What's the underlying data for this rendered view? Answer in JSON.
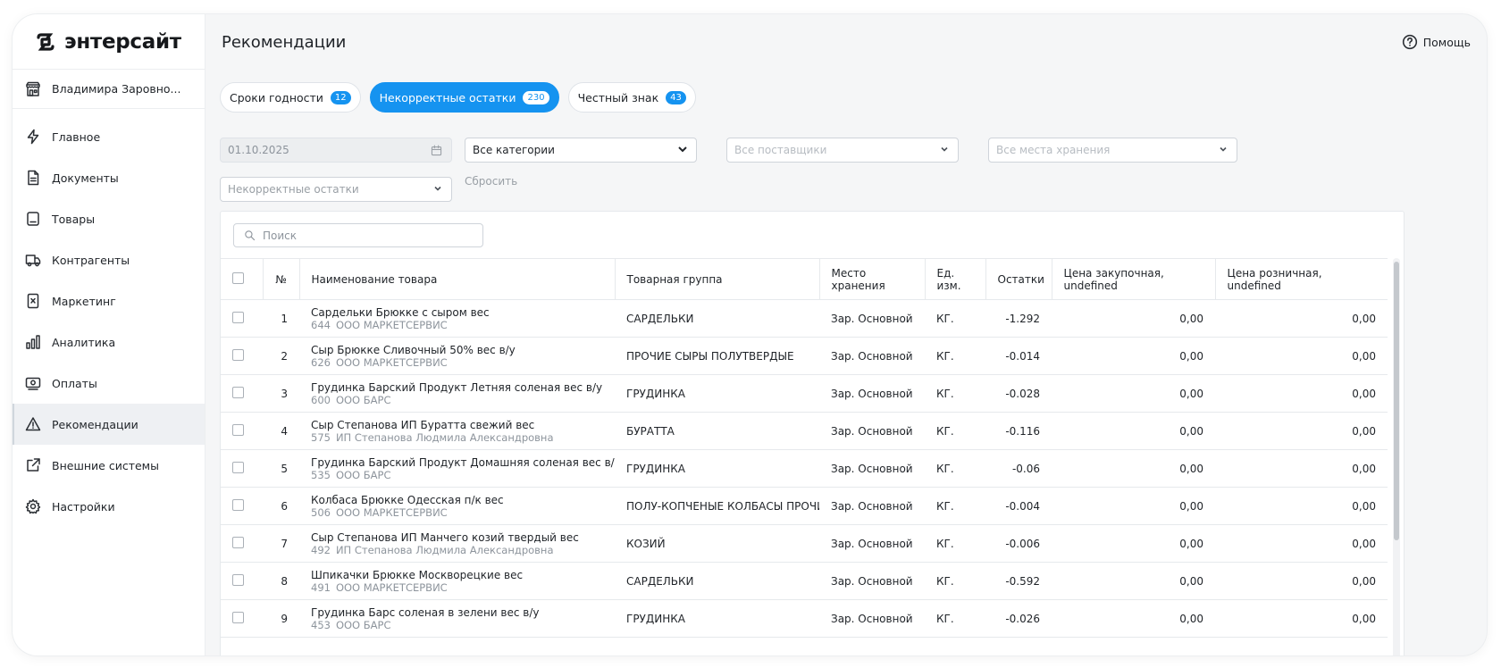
{
  "brand": {
    "name": "энтерсайт"
  },
  "store": {
    "name": "Владимира Заровно..."
  },
  "sidebar": {
    "items": [
      {
        "label": "Главное",
        "icon": "lightning-icon"
      },
      {
        "label": "Документы",
        "icon": "document-icon"
      },
      {
        "label": "Товары",
        "icon": "product-icon"
      },
      {
        "label": "Контрагенты",
        "icon": "truck-icon"
      },
      {
        "label": "Маркетинг",
        "icon": "marketing-icon"
      },
      {
        "label": "Аналитика",
        "icon": "bar-chart-icon"
      },
      {
        "label": "Оплаты",
        "icon": "payment-icon"
      },
      {
        "label": "Рекомендации",
        "icon": "warning-icon",
        "active": true
      },
      {
        "label": "Внешние системы",
        "icon": "external-link-icon"
      },
      {
        "label": "Настройки",
        "icon": "gear-icon"
      }
    ]
  },
  "header": {
    "title": "Рекомендации",
    "help_label": "Помощь"
  },
  "tabs": [
    {
      "label": "Сроки годности",
      "count": "12",
      "active": false
    },
    {
      "label": "Некорректные остатки",
      "count": "230",
      "active": true
    },
    {
      "label": "Честный знак",
      "count": "43",
      "active": false
    }
  ],
  "filters": {
    "date": "01.10.2025",
    "category": "Все категории",
    "supplier_placeholder": "Все поставщики",
    "storage_placeholder": "Все места хранения",
    "type_placeholder": "Некорректные остатки",
    "reset_label": "Сбросить"
  },
  "search": {
    "placeholder": "Поиск"
  },
  "table": {
    "columns": [
      "№",
      "Наименование товара",
      "Товарная группа",
      "Место хранения",
      "Ед. изм.",
      "Остатки",
      "Цена закупочная, undefined",
      "Цена розничная, undefined"
    ],
    "rows": [
      {
        "n": "1",
        "name": "Сардельки Брюкке с сыром вес",
        "code": "644",
        "supplier": "ООО МАРКЕТСЕРВИС",
        "group": "САРДЕЛЬКИ",
        "storage": "Зар. Основной",
        "unit": "КГ.",
        "stock": "-1.292",
        "purchase": "0,00",
        "retail": "0,00"
      },
      {
        "n": "2",
        "name": "Сыр Брюкке Сливочный 50% вес в/у",
        "code": "626",
        "supplier": "ООО МАРКЕТСЕРВИС",
        "group": "ПРОЧИЕ СЫРЫ ПОЛУТВЕРДЫЕ",
        "storage": "Зар. Основной",
        "unit": "КГ.",
        "stock": "-0.014",
        "purchase": "0,00",
        "retail": "0,00"
      },
      {
        "n": "3",
        "name": "Грудинка Барский Продукт Летняя соленая вес в/у",
        "code": "600",
        "supplier": "ООО БАРС",
        "group": "ГРУДИНКА",
        "storage": "Зар. Основной",
        "unit": "КГ.",
        "stock": "-0.028",
        "purchase": "0,00",
        "retail": "0,00"
      },
      {
        "n": "4",
        "name": "Сыр Степанова ИП Буратта свежий вес",
        "code": "575",
        "supplier": "ИП Степанова Людмила Александровна",
        "group": "БУРАТТА",
        "storage": "Зар. Основной",
        "unit": "КГ.",
        "stock": "-0.116",
        "purchase": "0,00",
        "retail": "0,00"
      },
      {
        "n": "5",
        "name": "Грудинка Барский Продукт Домашняя соленая вес в/у",
        "code": "535",
        "supplier": "ООО БАРС",
        "group": "ГРУДИНКА",
        "storage": "Зар. Основной",
        "unit": "КГ.",
        "stock": "-0.06",
        "purchase": "0,00",
        "retail": "0,00"
      },
      {
        "n": "6",
        "name": "Колбаса Брюкке Одесская п/к вес",
        "code": "506",
        "supplier": "ООО МАРКЕТСЕРВИС",
        "group": "ПОЛУ-КОПЧЕНЫЕ КОЛБАСЫ ПРОЧИЕ",
        "storage": "Зар. Основной",
        "unit": "КГ.",
        "stock": "-0.004",
        "purchase": "0,00",
        "retail": "0,00"
      },
      {
        "n": "7",
        "name": "Сыр Степанова ИП Манчего козий твердый вес",
        "code": "492",
        "supplier": "ИП Степанова Людмила Александровна",
        "group": "КОЗИЙ",
        "storage": "Зар. Основной",
        "unit": "КГ.",
        "stock": "-0.006",
        "purchase": "0,00",
        "retail": "0,00"
      },
      {
        "n": "8",
        "name": "Шпикачки Брюкке Москворецкие вес",
        "code": "491",
        "supplier": "ООО МАРКЕТСЕРВИС",
        "group": "САРДЕЛЬКИ",
        "storage": "Зар. Основной",
        "unit": "КГ.",
        "stock": "-0.592",
        "purchase": "0,00",
        "retail": "0,00"
      },
      {
        "n": "9",
        "name": "Грудинка Барс соленая в зелени вес в/у",
        "code": "453",
        "supplier": "ООО БАРС",
        "group": "ГРУДИНКА",
        "storage": "Зар. Основной",
        "unit": "КГ.",
        "stock": "-0.026",
        "purchase": "0,00",
        "retail": "0,00"
      }
    ]
  },
  "colors": {
    "accent": "#1593f0",
    "text": "#1f2328",
    "muted": "#8d949c"
  }
}
